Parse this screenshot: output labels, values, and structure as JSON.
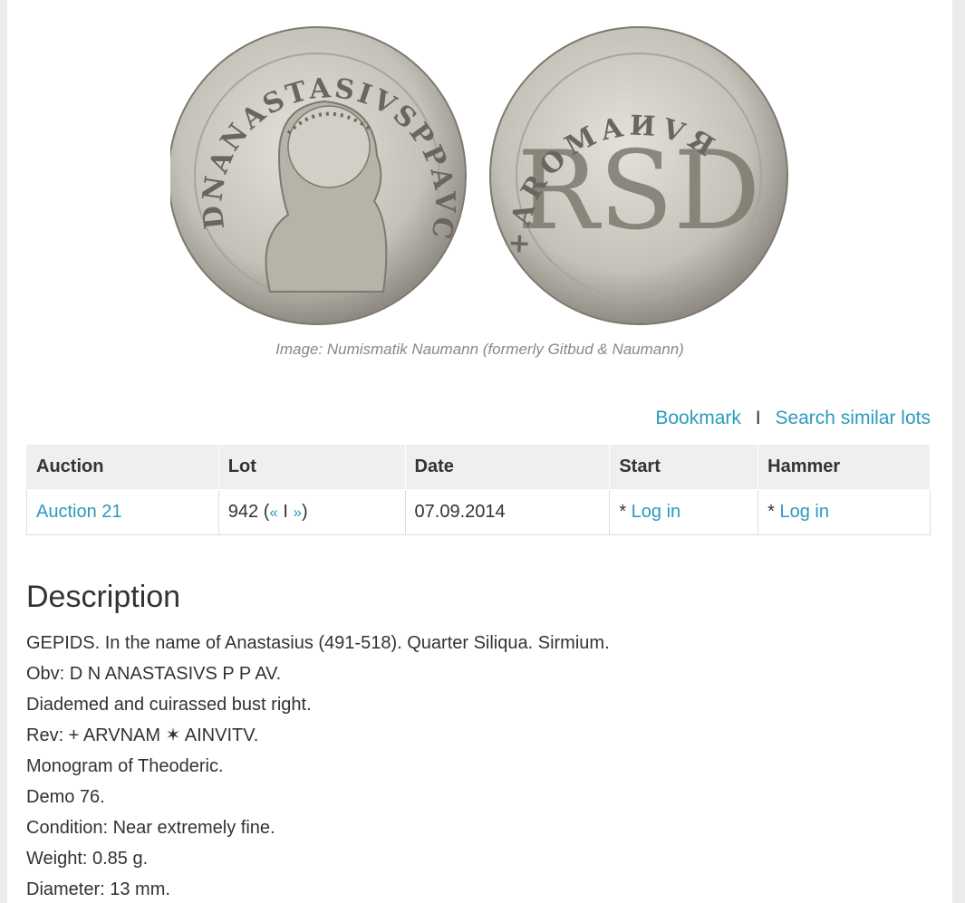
{
  "image": {
    "caption": "Image: Numismatik Naumann (formerly Gitbud & Naumann)",
    "obverse_legend": "DNANASTASIVSPPAVC",
    "reverse_legend": "+AROMAИVЯ",
    "colors": {
      "coin_silver": "#c9c6be",
      "coin_shadow": "#8f8b82"
    }
  },
  "actions": {
    "bookmark": "Bookmark",
    "separator": "I",
    "search_similar": "Search similar lots"
  },
  "table": {
    "headers": [
      "Auction",
      "Lot",
      "Date",
      "Start",
      "Hammer"
    ],
    "row": {
      "auction": "Auction 21",
      "lot_number": "942 (",
      "prev": "«",
      "divider": " I ",
      "next": "»",
      "lot_close": ")",
      "date": "07.09.2014",
      "start_prefix": "* ",
      "start_link": "Log in",
      "hammer_prefix": "* ",
      "hammer_link": "Log in"
    }
  },
  "description": {
    "title": "Description",
    "lines": [
      "GEPIDS. In the name of Anastasius (491-518). Quarter Siliqua. Sirmium.",
      "Obv: D N ANASTASIVS P P AV.",
      "Diademed and cuirassed bust right.",
      "Rev: + ARVNAM ✶ AINVITV.",
      "Monogram of Theoderic.",
      "Demo 76.",
      "Condition: Near extremely fine.",
      "Weight: 0.85 g.",
      "Diameter: 13 mm."
    ]
  }
}
